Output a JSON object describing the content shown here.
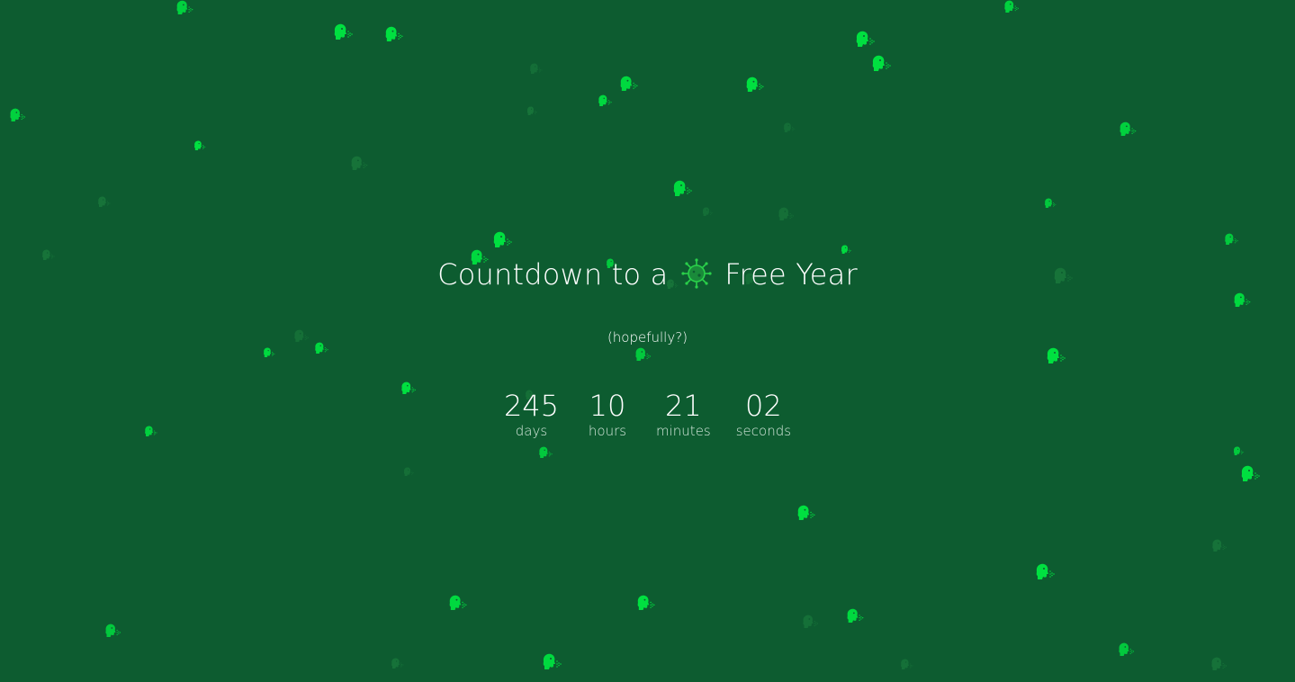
{
  "title": {
    "before": "Countdown to a",
    "icon": "virus-icon",
    "after": "Free Year"
  },
  "subtitle": "(hopefully?)",
  "countdown": {
    "days": "245",
    "days_label": "days",
    "hours": "10",
    "hours_label": "hours",
    "minutes": "21",
    "minutes_label": "minutes",
    "seconds": "02",
    "seconds_label": "seconds"
  },
  "background": {
    "color": "#0d5c30",
    "icon": "sneezing-face-icon",
    "icon_color_bright": "#00e040",
    "icon_color_faint": "#1a7a3c"
  }
}
